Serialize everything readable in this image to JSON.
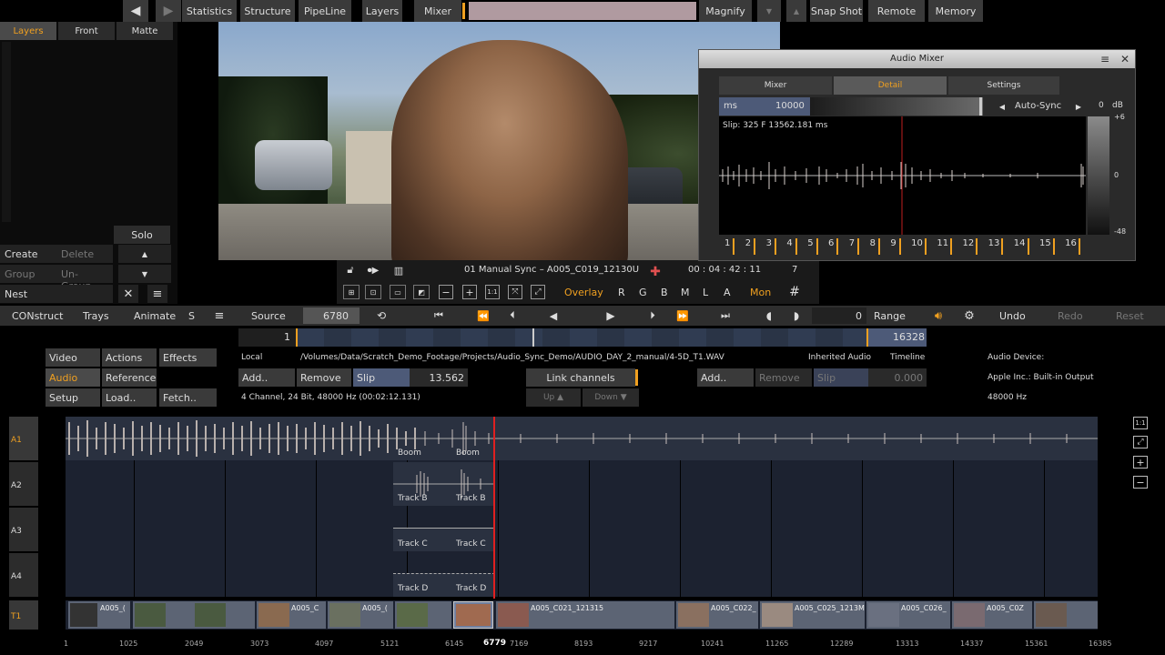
{
  "topbar": {
    "statistics": "Statistics",
    "structure": "Structure",
    "pipeline": "PipeLine",
    "layers": "Layers",
    "mixer": "Mixer",
    "magnify": "Magnify",
    "snapshot": "Snap Shot",
    "remote": "Remote",
    "memory": "Memory"
  },
  "leftpanel": {
    "tabs": [
      "Layers",
      "Front",
      "Matte"
    ],
    "solo": "Solo",
    "create": "Create",
    "delete": "Delete",
    "group": "Group",
    "ungroup": "Un-Group",
    "nest": "Nest"
  },
  "viewer": {
    "clipname": "01 Manual Sync – A005_C019_12130U",
    "timecode": "00 : 04 : 42 : 11",
    "frame": "7",
    "overlay": "Overlay",
    "r": "R",
    "g": "G",
    "b": "B",
    "m": "M",
    "l": "L",
    "a": "A",
    "mon": "Mon"
  },
  "audiomixer": {
    "title": "Audio Mixer",
    "tabs": [
      "Mixer",
      "Detail",
      "Settings"
    ],
    "unit": "ms",
    "value": "10000",
    "autosync": "Auto-Sync",
    "db_value": "0",
    "db_unit": "dB",
    "slip_info": "Slip:  325 F  13562.181 ms",
    "scale": [
      "+6",
      "0",
      "-48"
    ],
    "channels": [
      "1",
      "2",
      "3",
      "4",
      "5",
      "6",
      "7",
      "8",
      "9",
      "10",
      "11",
      "12",
      "13",
      "14",
      "15",
      "16"
    ]
  },
  "toolbar": {
    "construct": "CONstruct",
    "trays": "Trays",
    "animate": "Animate",
    "s": "S",
    "source": "Source",
    "source_val": "6780",
    "frame_val": "0",
    "range": "Range",
    "undo": "Undo",
    "redo": "Redo",
    "reset": "Reset",
    "range_start": "1",
    "range_end": "16328"
  },
  "menu": {
    "video": "Video",
    "actions": "Actions",
    "effects": "Effects",
    "audio": "Audio",
    "reference": "Reference",
    "setup": "Setup",
    "load": "Load..",
    "fetch": "Fetch.."
  },
  "audiopanel": {
    "local": "Local",
    "path": "/Volumes/Data/Scratch_Demo_Footage/Projects/Audio_Sync_Demo/AUDIO_DAY_2_manual/4-5D_T1.WAV",
    "inherited": "Inherited Audio",
    "timeline": "Timeline",
    "device_label": "Audio Device:",
    "device": "Apple Inc.: Built-in Output",
    "rate": "48000 Hz",
    "add": "Add..",
    "remove": "Remove",
    "slip": "Slip",
    "slip_val": "13.562",
    "format": "4 Channel, 24 Bit, 48000 Hz (00:02:12.131)",
    "link": "Link channels",
    "up": "Up",
    "down": "Down",
    "add2": "Add..",
    "remove2": "Remove",
    "slip2": "Slip",
    "slip2_val": "0.000"
  },
  "tracks": {
    "a1": "A1",
    "a2": "A2",
    "a3": "A3",
    "a4": "A4",
    "t1": "T1",
    "boom": "Boom",
    "trackb": "Track B",
    "trackc": "Track C",
    "trackd": "Track D"
  },
  "clips": [
    "A005_(",
    "A005_C",
    "A005_(",
    "A005_C021_121315",
    "A005_C022_",
    "A005_C025_1213M",
    "A005_C026_",
    "A005_C0Z"
  ],
  "ruler": [
    "1",
    "1025",
    "2049",
    "3073",
    "4097",
    "5121",
    "6145",
    "6779",
    "7169",
    "8193",
    "9217",
    "10241",
    "11265",
    "12289",
    "13313",
    "14337",
    "15361",
    "16385"
  ],
  "sideicons": {
    "fit": "1:1"
  }
}
